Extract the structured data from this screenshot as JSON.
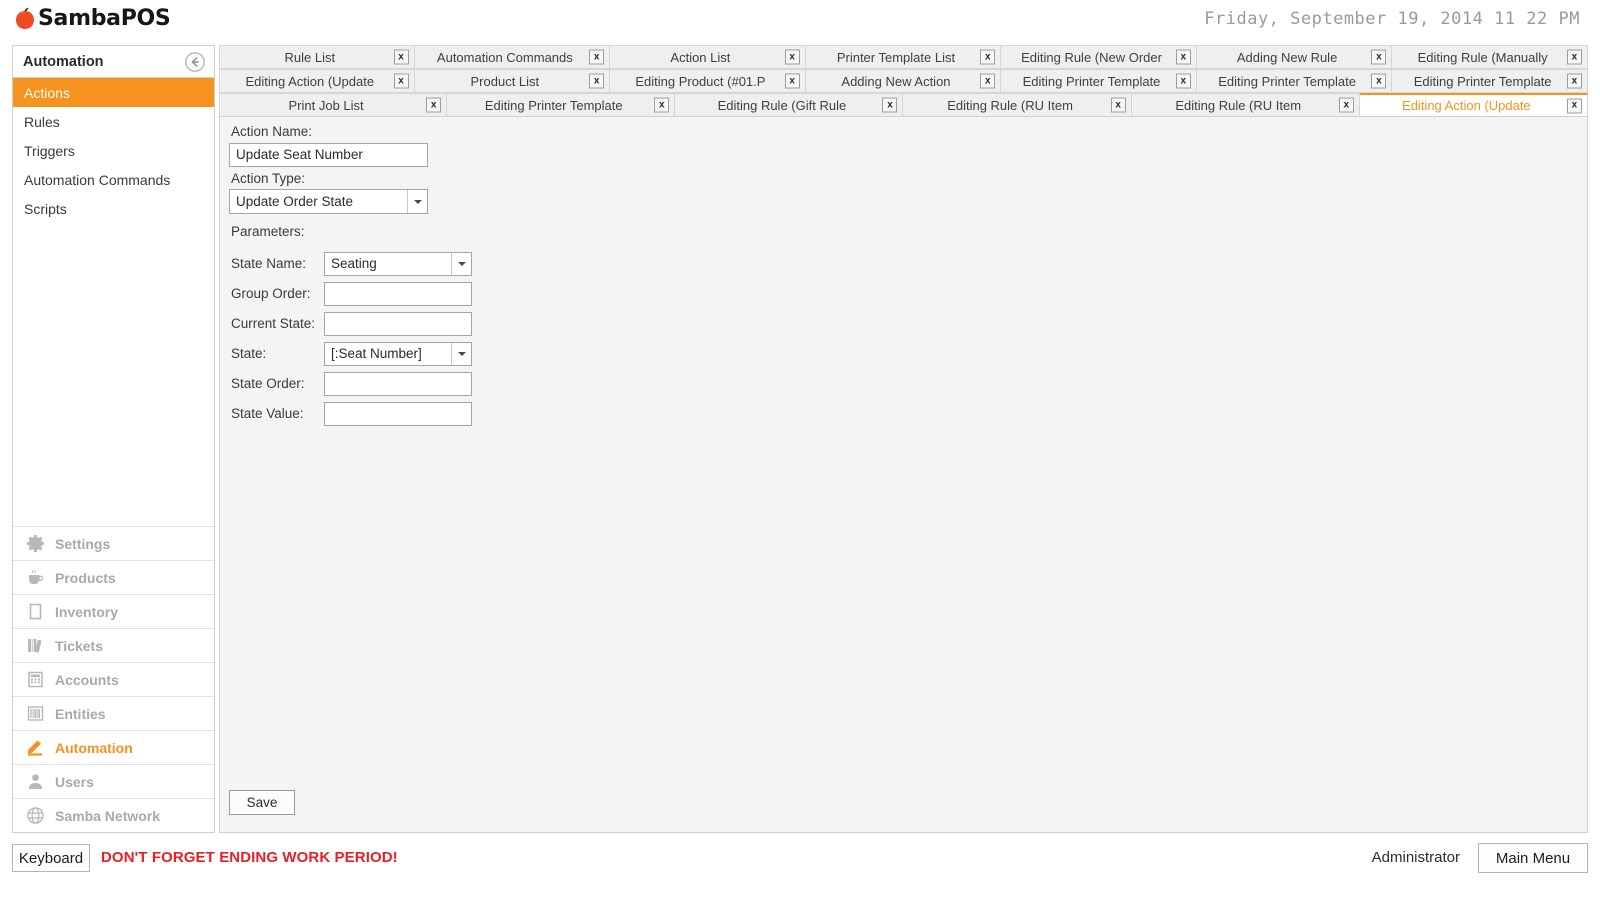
{
  "header": {
    "logo_text": "SambaPOS",
    "logo_icon": "tomato-icon",
    "logo_color": "#f04a23",
    "datetime": "Friday, September 19, 2014 11 22 PM"
  },
  "sidebar": {
    "title": "Automation",
    "collapse_icon": "arrow-left-circle-icon",
    "nav_items": [
      {
        "label": "Actions",
        "active": true
      },
      {
        "label": "Rules",
        "active": false
      },
      {
        "label": "Triggers",
        "active": false
      },
      {
        "label": "Automation Commands",
        "active": false
      },
      {
        "label": "Scripts",
        "active": false
      }
    ],
    "menu_items": [
      {
        "label": "Settings",
        "icon": "gear-icon",
        "active": false
      },
      {
        "label": "Products",
        "icon": "cup-icon",
        "active": false
      },
      {
        "label": "Inventory",
        "icon": "box-icon",
        "active": false
      },
      {
        "label": "Tickets",
        "icon": "books-icon",
        "active": false
      },
      {
        "label": "Accounts",
        "icon": "calculator-icon",
        "active": false
      },
      {
        "label": "Entities",
        "icon": "barcode-icon",
        "active": false
      },
      {
        "label": "Automation",
        "icon": "pencil-icon",
        "active": true
      },
      {
        "label": "Users",
        "icon": "person-icon",
        "active": false
      },
      {
        "label": "Samba Network",
        "icon": "globe-icon",
        "active": false
      }
    ]
  },
  "tabs": {
    "close_label": "x",
    "rows": [
      [
        {
          "label": "Rule List",
          "active": false
        },
        {
          "label": "Automation Commands",
          "active": false
        },
        {
          "label": "Action List",
          "active": false
        },
        {
          "label": "Printer Template List",
          "active": false
        },
        {
          "label": "Editing Rule (New Order",
          "active": false
        },
        {
          "label": "Adding New Rule",
          "active": false
        },
        {
          "label": "Editing Rule (Manually",
          "active": false
        }
      ],
      [
        {
          "label": "Editing Action (Update",
          "active": false
        },
        {
          "label": "Product List",
          "active": false
        },
        {
          "label": "Editing Product (#01.P",
          "active": false
        },
        {
          "label": "Adding New Action",
          "active": false
        },
        {
          "label": "Editing Printer Template",
          "active": false
        },
        {
          "label": "Editing Printer Template",
          "active": false
        },
        {
          "label": "Editing Printer Template",
          "active": false
        }
      ],
      [
        {
          "label": "Print Job List",
          "active": false
        },
        {
          "label": "Editing Printer Template",
          "active": false
        },
        {
          "label": "Editing Rule (Gift Rule",
          "active": false
        },
        {
          "label": "Editing Rule (RU Item",
          "active": false
        },
        {
          "label": "Editing Rule (RU Item",
          "active": false
        },
        {
          "label": "Editing Action (Update",
          "active": true
        }
      ]
    ]
  },
  "form": {
    "action_name_label": "Action Name:",
    "action_name_value": "Update Seat Number",
    "action_type_label": "Action Type:",
    "action_type_value": "Update Order State",
    "parameters_label": "Parameters:",
    "parameters": [
      {
        "label": "State Name:",
        "value": "Seating",
        "type": "combo"
      },
      {
        "label": "Group Order:",
        "value": "",
        "type": "input"
      },
      {
        "label": "Current State:",
        "value": "",
        "type": "input"
      },
      {
        "label": "State:",
        "value": "[:Seat Number]",
        "type": "combo"
      },
      {
        "label": "State Order:",
        "value": "",
        "type": "input"
      },
      {
        "label": "State Value:",
        "value": "",
        "type": "input"
      }
    ],
    "save_label": "Save"
  },
  "status_bar": {
    "keyboard_label": "Keyboard",
    "warning": "DON'T FORGET ENDING WORK PERIOD!",
    "warning_color": "#ee1c25",
    "user": "Administrator",
    "main_menu_label": "Main Menu"
  }
}
